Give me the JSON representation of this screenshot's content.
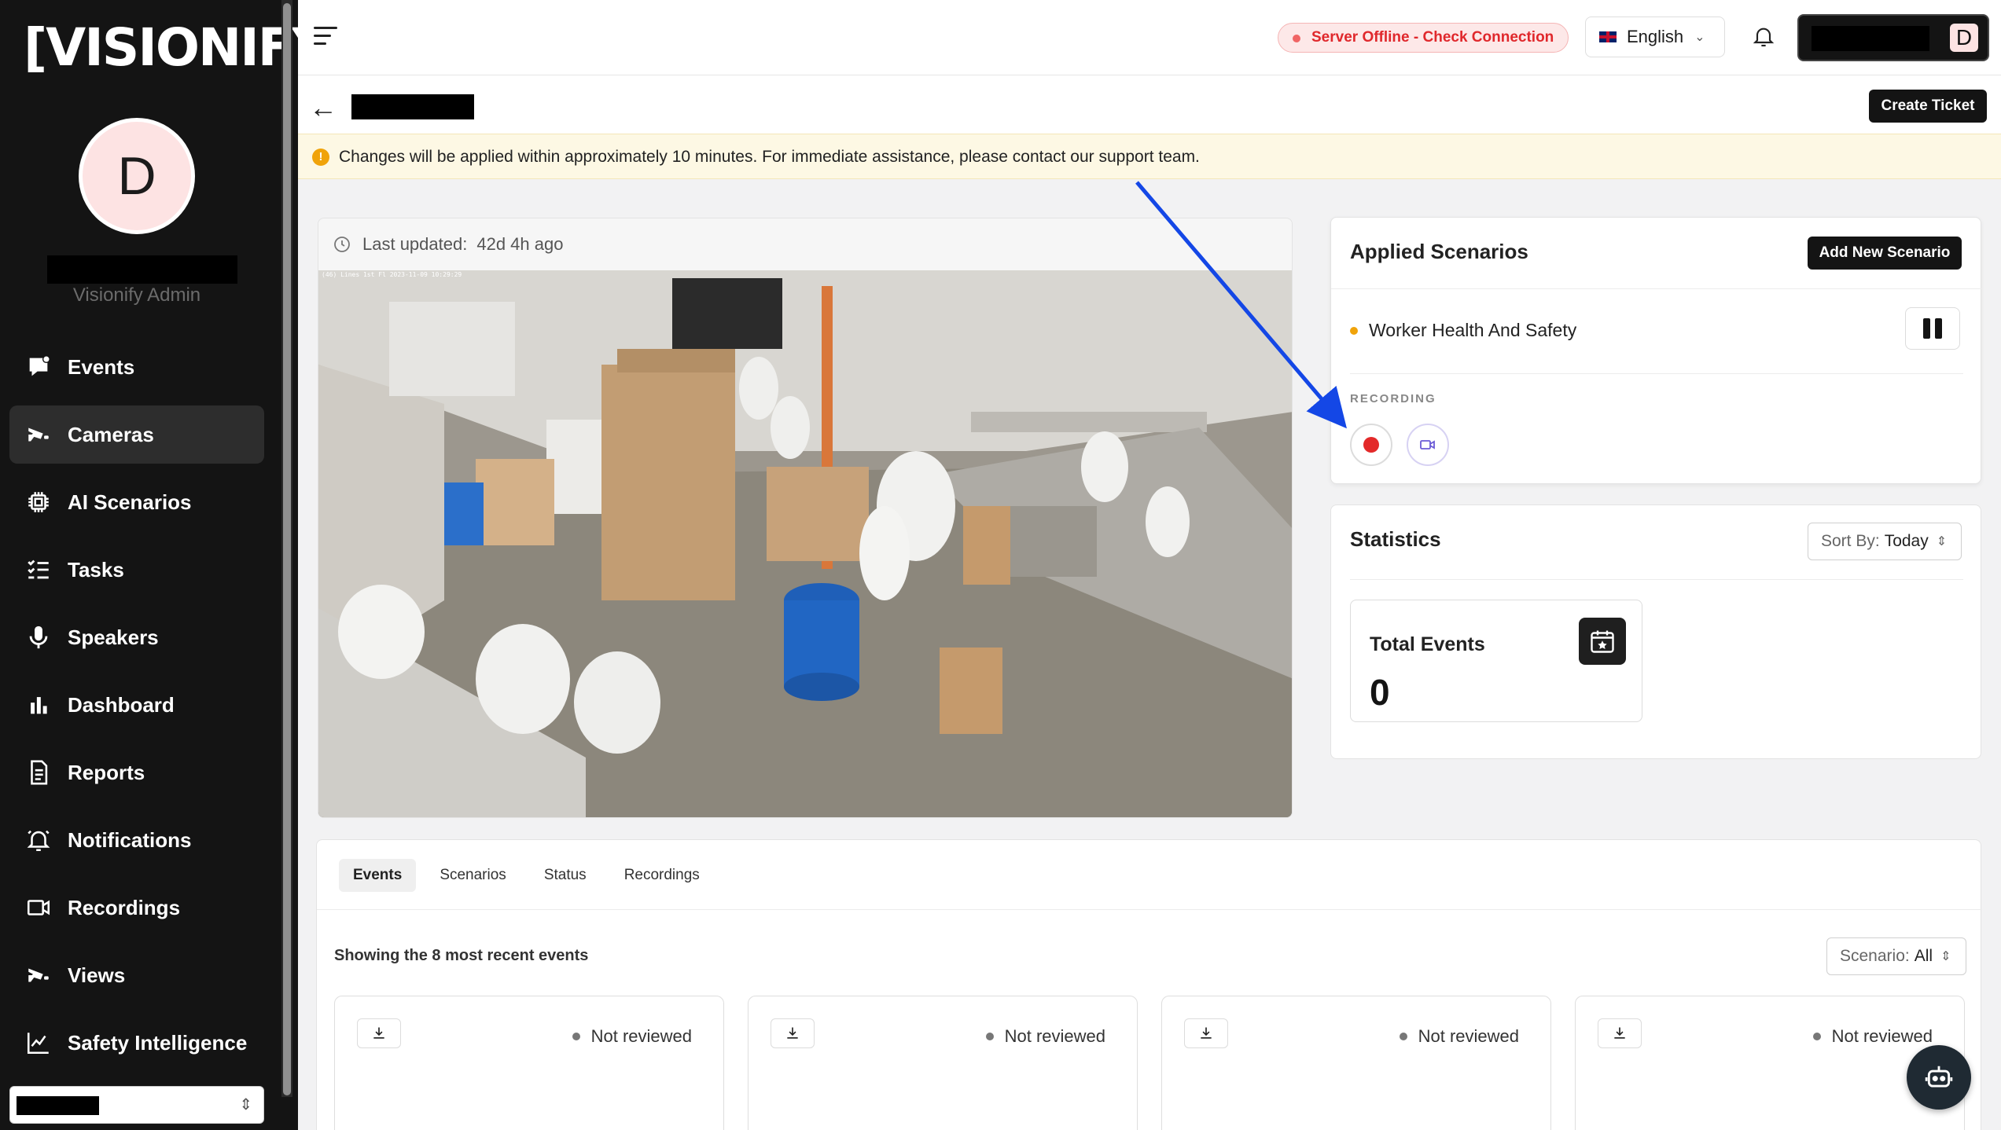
{
  "sidebar": {
    "logo": "[VISIONIFY]",
    "avatar_letter": "D",
    "role": "Visionify Admin",
    "items": [
      {
        "label": "Events",
        "icon": "events-icon"
      },
      {
        "label": "Cameras",
        "icon": "camera-icon",
        "active": true
      },
      {
        "label": "AI Scenarios",
        "icon": "chip-icon"
      },
      {
        "label": "Tasks",
        "icon": "tasks-icon"
      },
      {
        "label": "Speakers",
        "icon": "microphone-icon"
      },
      {
        "label": "Dashboard",
        "icon": "bar-chart-icon"
      },
      {
        "label": "Reports",
        "icon": "report-icon"
      },
      {
        "label": "Notifications",
        "icon": "bell-icon"
      },
      {
        "label": "Recordings",
        "icon": "video-icon"
      },
      {
        "label": "Views",
        "icon": "camera-icon"
      },
      {
        "label": "Safety Intelligence",
        "icon": "line-chart-icon"
      }
    ]
  },
  "topbar": {
    "server_status": "Server Offline - Check Connection",
    "language": "English",
    "user_avatar_letter": "D"
  },
  "subheader": {
    "create_ticket_label": "Create Ticket",
    "banner_text": "Changes will be applied within approximately 10 minutes. For immediate assistance, please contact our support team."
  },
  "camera": {
    "last_updated_label": "Last updated:",
    "last_updated_value": "42d 4h ago",
    "overlay_text": "(46) Lines 1st Fl 2023-11-09 10:29:29"
  },
  "applied_scenarios": {
    "title": "Applied Scenarios",
    "add_label": "Add New Scenario",
    "scenarios": [
      {
        "name": "Worker Health And Safety",
        "status_color": "#f0a30a"
      }
    ],
    "recording_label": "RECORDING"
  },
  "statistics": {
    "title": "Statistics",
    "sort_label": "Sort By:",
    "sort_value": "Today",
    "total_events_label": "Total Events",
    "total_events_value": "0"
  },
  "events_panel": {
    "tabs": [
      "Events",
      "Scenarios",
      "Status",
      "Recordings"
    ],
    "active_tab": "Events",
    "summary": "Showing the 8 most recent events",
    "scenario_filter_label": "Scenario:",
    "scenario_filter_value": "All",
    "cards": [
      {
        "status": "Not reviewed"
      },
      {
        "status": "Not reviewed"
      },
      {
        "status": "Not reviewed"
      },
      {
        "status": "Not reviewed"
      }
    ]
  },
  "colors": {
    "sidebar_bg": "#141414",
    "offline_text": "#e0282c",
    "banner_bg": "#fdf8e4",
    "scenario_dot": "#f0a30a",
    "record_red": "#e32929",
    "annotation_arrow": "#1447e6"
  }
}
